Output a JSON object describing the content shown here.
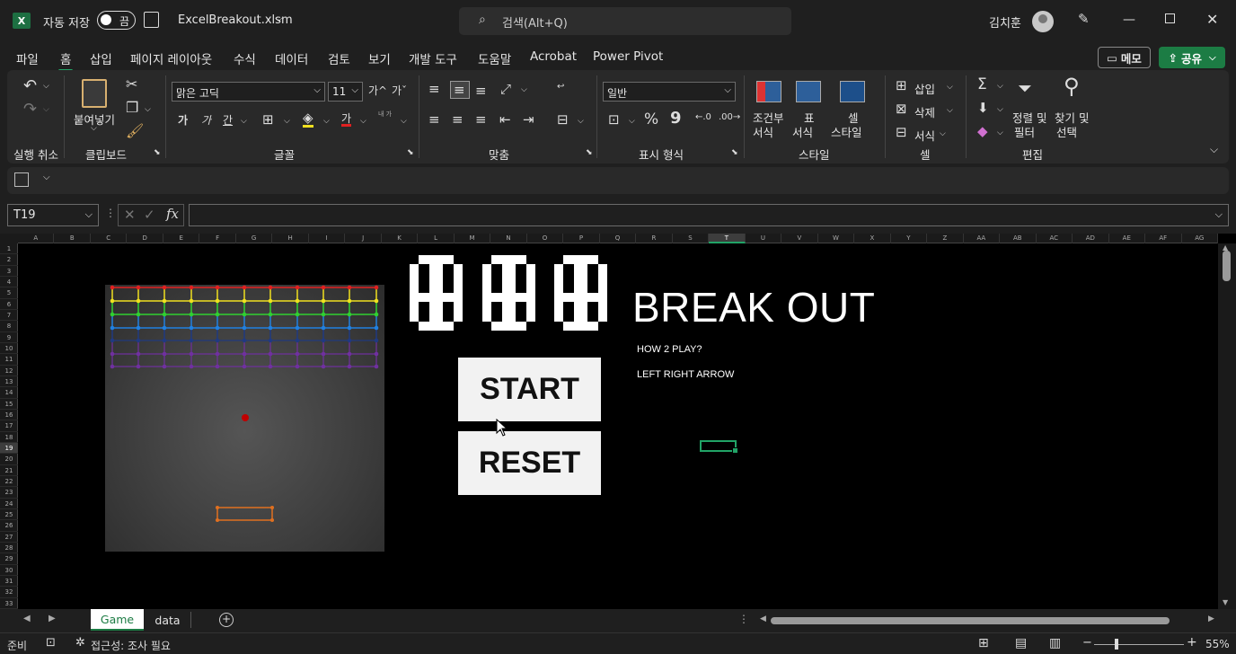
{
  "titlebar": {
    "app_logo": "X",
    "autosave_label": "자동 저장",
    "autosave_state": "끔",
    "filename": "ExcelBreakout.xlsm",
    "search_placeholder": "검색(Alt+Q)",
    "user_name": "김치훈"
  },
  "tabs": [
    "파일",
    "홈",
    "삽입",
    "페이지 레이아웃",
    "수식",
    "데이터",
    "검토",
    "보기",
    "개발 도구",
    "도움말",
    "Acrobat",
    "Power Pivot"
  ],
  "active_tab": "홈",
  "memo_label": "메모",
  "share_label": "공유",
  "ribbon": {
    "groups": [
      "실행 취소",
      "클립보드",
      "글꼴",
      "맞춤",
      "표시 형식",
      "스타일",
      "셀",
      "편집"
    ],
    "paste_label": "붙여넣기",
    "font_name": "맑은 고딕",
    "font_size": "11",
    "bold": "가",
    "italic": "가",
    "underline": "간",
    "number_format": "일반",
    "cond_format_1": "조건부",
    "cond_format_2": "서식",
    "table_format_1": "표",
    "table_format_2": "서식",
    "cell_style_1": "셀",
    "cell_style_2": "스타일",
    "insert_label": "삽입",
    "delete_label": "삭제",
    "format_label": "서식",
    "sort_1": "정렬 및",
    "sort_2": "필터",
    "find_1": "찾기 및",
    "find_2": "선택",
    "percent": "%",
    "comma": "9",
    "wrap_text": "내 가",
    "inc_font": "가^",
    "dec_font": "가ˇ",
    "font_color_glyph": "가"
  },
  "formula_bar": {
    "name_box": "T19",
    "fx": "fx",
    "formula": ""
  },
  "columns": [
    "A",
    "B",
    "C",
    "D",
    "E",
    "F",
    "G",
    "H",
    "I",
    "J",
    "K",
    "L",
    "M",
    "N",
    "O",
    "P",
    "Q",
    "R",
    "S",
    "T",
    "U",
    "V",
    "W",
    "X",
    "Y",
    "Z",
    "AA",
    "AB",
    "AC",
    "AD",
    "AE",
    "AF",
    "AG"
  ],
  "selected_column": "T",
  "rows": [
    "1",
    "2",
    "3",
    "4",
    "5",
    "6",
    "7",
    "8",
    "9",
    "10",
    "11",
    "12",
    "13",
    "14",
    "15",
    "16",
    "17",
    "18",
    "19",
    "20",
    "21",
    "22",
    "23",
    "24",
    "25",
    "26",
    "27",
    "28",
    "29",
    "30",
    "31",
    "32",
    "33"
  ],
  "selected_row": "19",
  "game": {
    "score_digits": [
      "0",
      "0",
      "0"
    ],
    "title": "BREAK OUT",
    "how_to_play": "HOW 2 PLAY?",
    "controls": "LEFT RIGHT ARROW",
    "start_label": "START",
    "reset_label": "RESET",
    "brick_row_colors": [
      "#e02020",
      "#f0e020",
      "#30d030",
      "#2080e0",
      "#203a80",
      "#7030a0"
    ],
    "ball_color": "#c00000",
    "paddle_color": "#e07020"
  },
  "sheets": [
    "Game",
    "data"
  ],
  "active_sheet": "Game",
  "status": {
    "ready": "준비",
    "accessibility": "접근성: 조사 필요",
    "zoom": "55%"
  }
}
